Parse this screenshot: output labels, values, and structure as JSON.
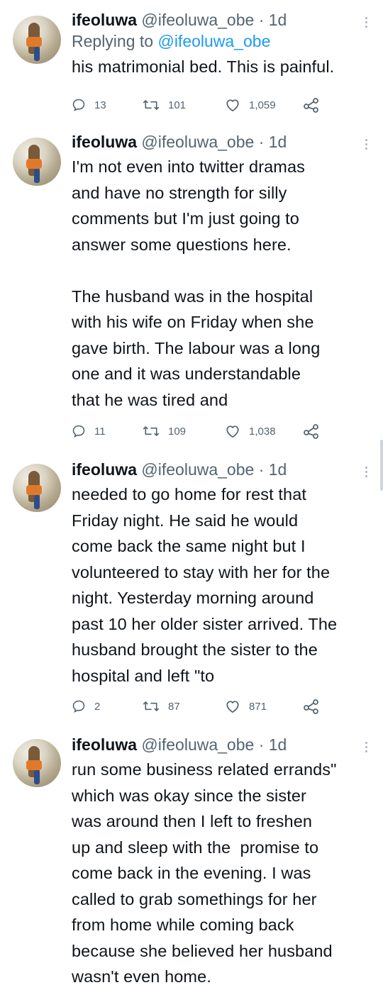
{
  "tweets": [
    {
      "name": "ifeoluwa",
      "handle": "@ifeoluwa_obe",
      "time": "· 1d",
      "replying_prefix": "Replying to ",
      "replying_to": "@ifeoluwa_obe",
      "text": "his matrimonial bed. This is painful.",
      "replies": "13",
      "retweets": "101",
      "likes": "1,059"
    },
    {
      "name": "ifeoluwa",
      "handle": "@ifeoluwa_obe",
      "time": "· 1d",
      "text": "I'm not even into twitter dramas\nand have no strength for silly\ncomments but I'm just going to\nanswer some questions here.\n\nThe husband was in the hospital\nwith his wife on Friday when she\ngave birth. The labour was a long\none and it was understandable\nthat he was tired and",
      "replies": "11",
      "retweets": "109",
      "likes": "1,038"
    },
    {
      "name": "ifeoluwa",
      "handle": "@ifeoluwa_obe",
      "time": "· 1d",
      "text": "needed to go home for rest that\nFriday night. He said he would\ncome back the same night but I\nvolunteered to stay with her for the\nnight. Yesterday morning around\npast 10 her older sister arrived. The\nhusband brought the sister to the\nhospital and left \"to",
      "replies": "2",
      "retweets": "87",
      "likes": "871"
    },
    {
      "name": "ifeoluwa",
      "handle": "@ifeoluwa_obe",
      "time": "· 1d",
      "text": "run some business related errands\"\nwhich was okay since the sister\nwas around then I left to freshen\nup and sleep with the  promise to\ncome back in the evening. I was\ncalled to grab somethings for her\nfrom home while coming back\nbecause she believed her husband\nwasn't even home."
    }
  ],
  "icons": {
    "reply": "reply-icon",
    "retweet": "retweet-icon",
    "like": "heart-icon",
    "share": "share-icon",
    "more": "more-icon"
  },
  "colors": {
    "text": "#0f1419",
    "muted": "#536471",
    "link": "#1d9bf0"
  }
}
